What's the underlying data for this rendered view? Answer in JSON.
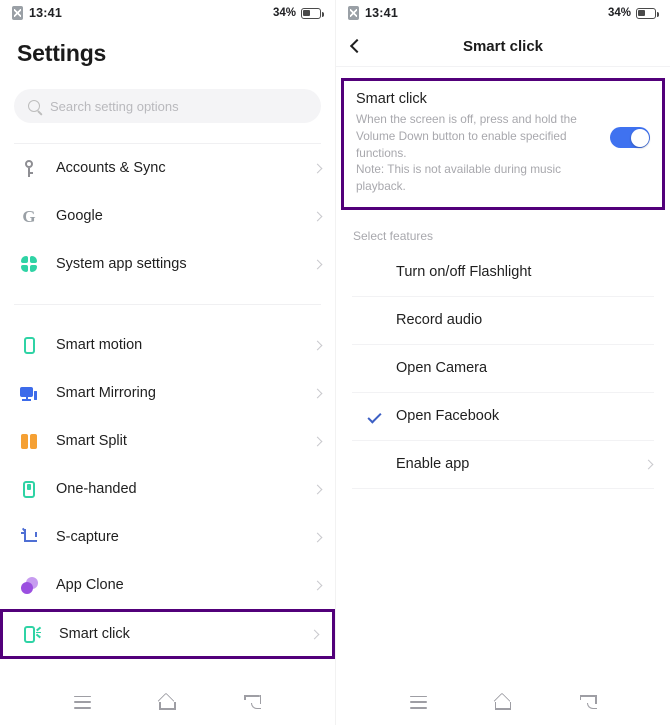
{
  "status_bar": {
    "time": "13:41",
    "battery_percent": "34%",
    "sim_icon": "sim-card-icon",
    "battery_icon": "battery-icon"
  },
  "colors": {
    "highlight_purple": "#52007a",
    "toggle_on_blue": "#3f72f0",
    "check_blue": "#3c5fc4",
    "accent_teal": "#2fd3a5",
    "accent_orange": "#f5a033",
    "accent_blue": "#3d6bea",
    "accent_purple": "#9b4fe0"
  },
  "left_screen": {
    "title": "Settings",
    "search": {
      "placeholder": "Search setting options",
      "value": "",
      "icon": "search-icon"
    },
    "groups": [
      {
        "items": [
          {
            "label": "Accounts & Sync",
            "icon": "key-icon",
            "chevron": true,
            "highlighted": false
          },
          {
            "label": "Google",
            "icon": "google-icon",
            "chevron": true,
            "highlighted": false
          },
          {
            "label": "System app settings",
            "icon": "clover-icon",
            "chevron": true,
            "highlighted": false
          }
        ]
      },
      {
        "items": [
          {
            "label": "Smart motion",
            "icon": "phone-icon",
            "chevron": true,
            "highlighted": false
          },
          {
            "label": "Smart Mirroring",
            "icon": "screen-mirror-icon",
            "chevron": true,
            "highlighted": false
          },
          {
            "label": "Smart Split",
            "icon": "split-screen-icon",
            "chevron": true,
            "highlighted": false
          },
          {
            "label": "One-handed",
            "icon": "one-handed-icon",
            "chevron": true,
            "highlighted": false
          },
          {
            "label": "S-capture",
            "icon": "crop-capture-icon",
            "chevron": true,
            "highlighted": false
          },
          {
            "label": "App Clone",
            "icon": "app-clone-icon",
            "chevron": true,
            "highlighted": false
          },
          {
            "label": "Smart click",
            "icon": "smart-click-icon",
            "chevron": true,
            "highlighted": true
          }
        ]
      }
    ]
  },
  "right_screen": {
    "nav": {
      "back_icon": "back-chevron-icon",
      "title": "Smart click"
    },
    "card": {
      "title": "Smart click",
      "description": "When the screen is off, press and hold the Volume Down button to enable specified functions.\nNote: This is not available during music playback.",
      "toggle_on": true,
      "highlighted": true
    },
    "section_label": "Select features",
    "features": [
      {
        "label": "Turn on/off Flashlight",
        "checked": false,
        "chevron": false
      },
      {
        "label": "Record audio",
        "checked": false,
        "chevron": false
      },
      {
        "label": "Open Camera",
        "checked": false,
        "chevron": false
      },
      {
        "label": "Open Facebook",
        "checked": true,
        "chevron": false
      },
      {
        "label": "Enable app",
        "checked": false,
        "chevron": true
      }
    ]
  },
  "nav_bar": {
    "recent_icon": "recents-icon",
    "home_icon": "home-icon",
    "back_icon": "back-icon"
  }
}
